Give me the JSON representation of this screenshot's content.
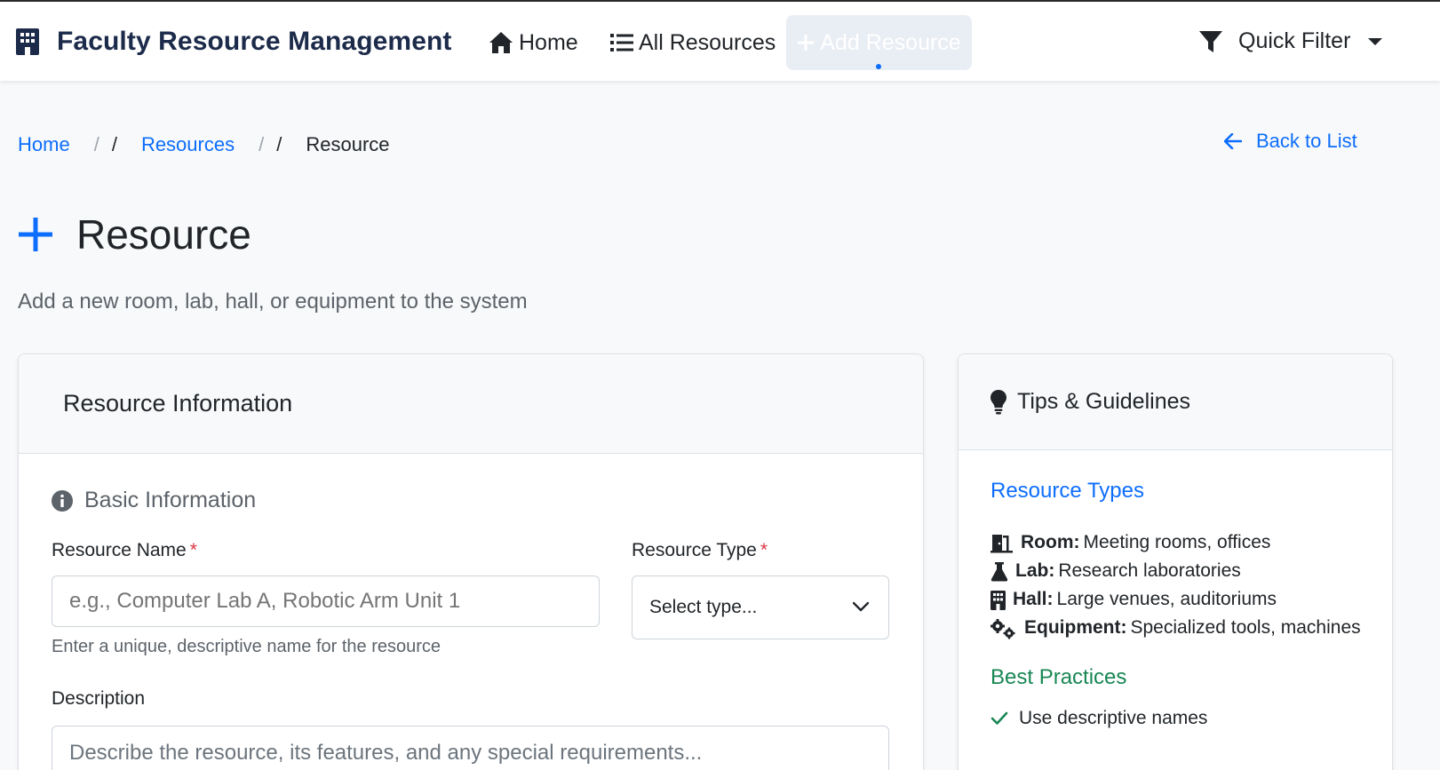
{
  "nav": {
    "brand": "Faculty Resource Management",
    "home": "Home",
    "all_resources": "All Resources",
    "add_resource": "Add Resource",
    "quick_filter": "Quick Filter"
  },
  "breadcrumb": {
    "home": "Home",
    "resources": "Resources",
    "current": "Resource",
    "sep": "/"
  },
  "back_link": "Back to List",
  "page": {
    "title": "Resource",
    "subtitle": "Add a new room, lab, hall, or equipment to the system"
  },
  "form": {
    "card_title": "Resource Information",
    "section_basic": "Basic Information",
    "name_label": "Resource Name",
    "name_placeholder": "e.g., Computer Lab A, Robotic Arm Unit 1",
    "name_help": "Enter a unique, descriptive name for the resource",
    "type_label": "Resource Type",
    "type_selected": "Select type...",
    "description_label": "Description",
    "description_placeholder": "Describe the resource, its features, and any special requirements...",
    "required_mark": "*"
  },
  "tips": {
    "title": "Tips & Guidelines",
    "types_heading": "Resource Types",
    "types": [
      {
        "name": "Room:",
        "desc": "Meeting rooms, offices",
        "icon": "door-open-icon"
      },
      {
        "name": "Lab:",
        "desc": "Research laboratories",
        "icon": "flask-icon"
      },
      {
        "name": "Hall:",
        "desc": "Large venues, auditoriums",
        "icon": "building-icon"
      },
      {
        "name": "Equipment:",
        "desc": "Specialized tools, machines",
        "icon": "gears-icon"
      }
    ],
    "best_practices_heading": "Best Practices",
    "best_practices": [
      "Use descriptive names"
    ]
  },
  "colors": {
    "accent": "#0d6efd",
    "brand_text": "#1c2b4a",
    "required": "#dc3545",
    "success": "#198754"
  }
}
